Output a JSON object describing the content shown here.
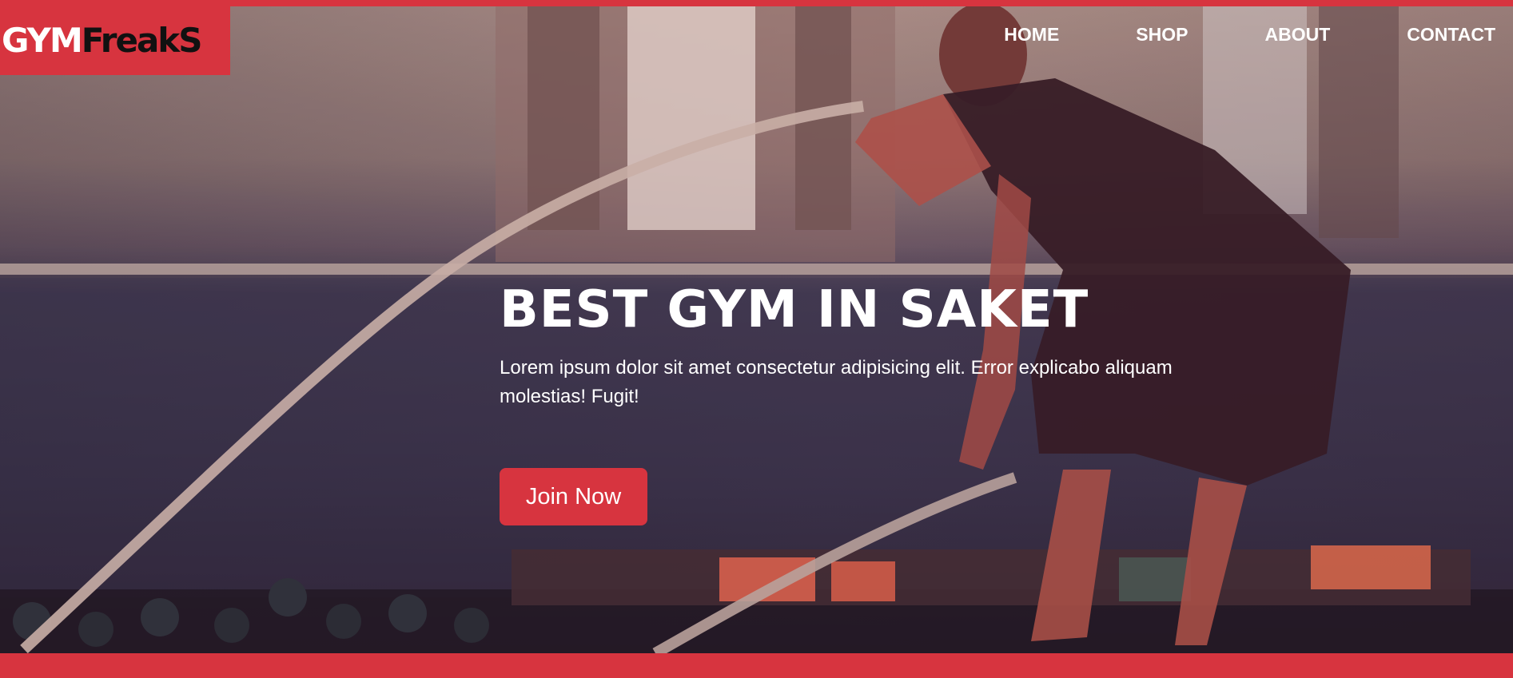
{
  "brand": {
    "part1": "GYM",
    "part2": "FreakS"
  },
  "nav": {
    "items": [
      "HOME",
      "SHOP",
      "ABOUT",
      "CONTACT"
    ]
  },
  "hero": {
    "headline": "BEST GYM IN SAKET",
    "description": "Lorem ipsum dolor sit amet consectetur adipisicing elit. Error explicabo aliquam molestias! Fugit!",
    "cta_label": "Join Now"
  },
  "colors": {
    "accent": "#d7343f",
    "text_light": "#ffffff",
    "text_dark": "#111111"
  }
}
